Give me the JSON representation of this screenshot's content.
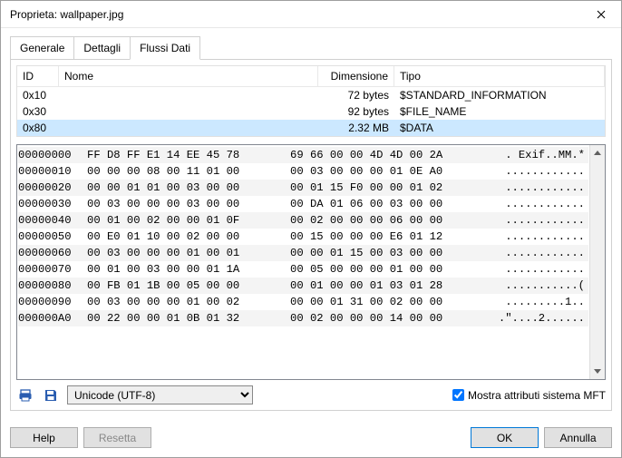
{
  "title": "Proprieta: wallpaper.jpg",
  "tabs": {
    "t0": "Generale",
    "t1": "Dettagli",
    "t2": "Flussi Dati"
  },
  "cols": {
    "id": "ID",
    "nome": "Nome",
    "dim": "Dimensione",
    "tipo": "Tipo"
  },
  "rows": [
    {
      "id": "0x10",
      "nome": "",
      "dim": "72 bytes",
      "tipo": "$STANDARD_INFORMATION"
    },
    {
      "id": "0x30",
      "nome": "",
      "dim": "92 bytes",
      "tipo": "$FILE_NAME"
    },
    {
      "id": "0x80",
      "nome": "",
      "dim": "2.32 MB",
      "tipo": "$DATA"
    }
  ],
  "hex": [
    {
      "o": "00000000",
      "a": "FF D8 FF E1 14 EE 45 78",
      "b": "69 66 00 00 4D 4D 00 2A",
      "t": ". Exif..MM.*"
    },
    {
      "o": "00000010",
      "a": "00 00 00 08 00 11 01 00",
      "b": "00 03 00 00 00 01 0E A0",
      "t": "............"
    },
    {
      "o": "00000020",
      "a": "00 00 01 01 00 03 00 00",
      "b": "00 01 15 F0 00 00 01 02",
      "t": "............"
    },
    {
      "o": "00000030",
      "a": "00 03 00 00 00 03 00 00",
      "b": "00 DA 01 06 00 03 00 00",
      "t": "............"
    },
    {
      "o": "00000040",
      "a": "00 01 00 02 00 00 01 0F",
      "b": "00 02 00 00 00 06 00 00",
      "t": "............"
    },
    {
      "o": "00000050",
      "a": "00 E0 01 10 00 02 00 00",
      "b": "00 15 00 00 00 E6 01 12",
      "t": "............"
    },
    {
      "o": "00000060",
      "a": "00 03 00 00 00 01 00 01",
      "b": "00 00 01 15 00 03 00 00",
      "t": "............"
    },
    {
      "o": "00000070",
      "a": "00 01 00 03 00 00 01 1A",
      "b": "00 05 00 00 00 01 00 00",
      "t": "............"
    },
    {
      "o": "00000080",
      "a": "00 FB 01 1B 00 05 00 00",
      "b": "00 01 00 00 01 03 01 28",
      "t": "...........("
    },
    {
      "o": "00000090",
      "a": "00 03 00 00 00 01 00 02",
      "b": "00 00 01 31 00 02 00 00",
      "t": ".........1.."
    },
    {
      "o": "000000A0",
      "a": "00 22 00 00 01 0B 01 32",
      "b": "00 02 00 00 00 14 00 00",
      "t": ".\"....2......"
    }
  ],
  "encoding": "Unicode (UTF-8)",
  "mft_label": "Mostra attributi sistema MFT",
  "buttons": {
    "help": "Help",
    "reset": "Resetta",
    "ok": "OK",
    "cancel": "Annulla"
  }
}
